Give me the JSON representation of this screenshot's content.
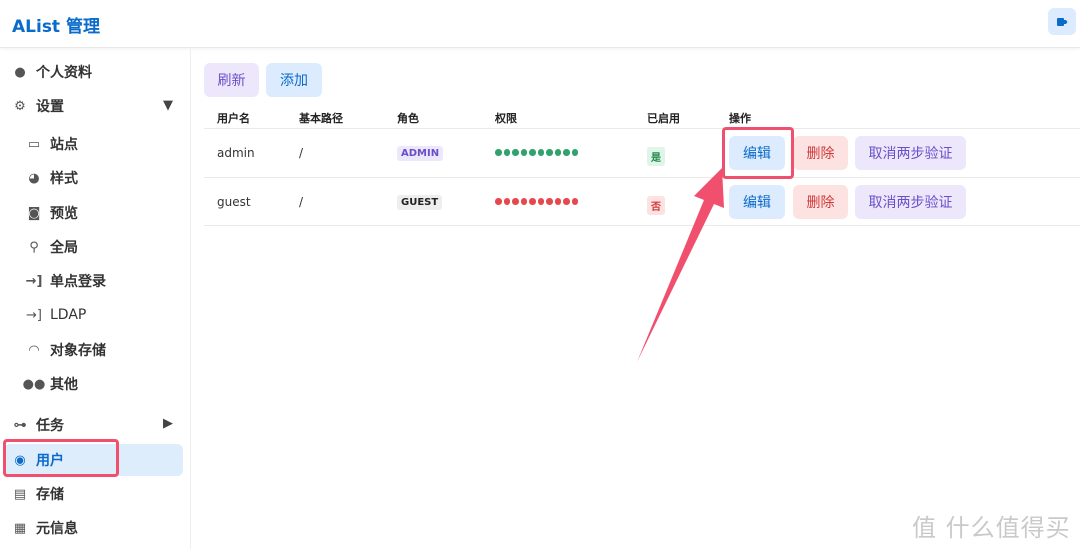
{
  "header": {
    "title": "AList 管理",
    "logout_icon": "logout-icon"
  },
  "sidebar": {
    "items": [
      {
        "label": "个人资料",
        "icon": "profile-icon"
      },
      {
        "label": "设置",
        "icon": "gear-icon"
      },
      {
        "label": "站点",
        "icon": "window-icon"
      },
      {
        "label": "样式",
        "icon": "palette-icon"
      },
      {
        "label": "预览",
        "icon": "camera-icon"
      },
      {
        "label": "全局",
        "icon": "joystick-icon"
      },
      {
        "label": "单点登录",
        "icon": "login-icon"
      },
      {
        "label": "LDAP",
        "icon": "login-icon"
      },
      {
        "label": "对象存储",
        "icon": "bucket-icon"
      },
      {
        "label": "其他",
        "icon": "dots-icon"
      },
      {
        "label": "任务",
        "icon": "tasks-icon"
      },
      {
        "label": "用户",
        "icon": "user-circle-icon"
      },
      {
        "label": "存储",
        "icon": "storage-icon"
      },
      {
        "label": "元信息",
        "icon": "meta-icon"
      }
    ]
  },
  "toolbar": {
    "refresh": "刷新",
    "add": "添加"
  },
  "table": {
    "headers": [
      "用户名",
      "基本路径",
      "角色",
      "权限",
      "已启用",
      "操作"
    ],
    "rows": [
      {
        "username": "admin",
        "path": "/",
        "role": "ADMIN",
        "permission_color": "#2fa36b",
        "permissions_on": 10,
        "enabled": "是",
        "edit": "编辑",
        "delete": "删除",
        "disable_2fa": "取消两步验证"
      },
      {
        "username": "guest",
        "path": "/",
        "role": "GUEST",
        "permission_color": "#e5484d",
        "permissions_on": 0,
        "enabled": "否",
        "edit": "编辑",
        "delete": "删除",
        "disable_2fa": "取消两步验证"
      }
    ]
  },
  "watermark": "值 什么值得买"
}
